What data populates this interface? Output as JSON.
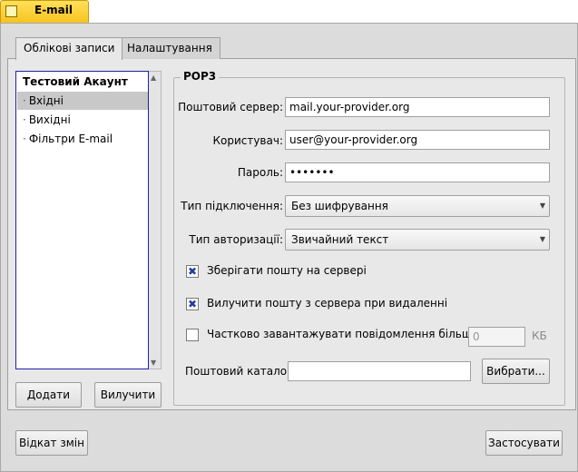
{
  "window": {
    "title": "E-mail"
  },
  "tabs": [
    {
      "label": "Облікові записи",
      "active": true
    },
    {
      "label": "Налаштування",
      "active": false
    }
  ],
  "accounts": {
    "root": "Тестовий Акаунт",
    "items": [
      {
        "label": "Вхідні",
        "selected": true
      },
      {
        "label": "Вихідні",
        "selected": false
      },
      {
        "label": "Фільтри E-mail",
        "selected": false
      }
    ],
    "bullet": "·",
    "add_label": "Додати",
    "remove_label": "Вилучити"
  },
  "pop3": {
    "group_title": "POP3",
    "server_label": "Поштовий сервер:",
    "server_value": "mail.your-provider.org",
    "user_label": "Користувач:",
    "user_value": "user@your-provider.org",
    "password_label": "Пароль:",
    "password_value": "•••••••",
    "connection_label": "Тип підключення:",
    "connection_value": "Без шифрування",
    "auth_label": "Тип авторизації:",
    "auth_value": "Звичайний текст",
    "keep_on_server_label": "Зберігати пошту на сервері",
    "keep_on_server_checked": true,
    "delete_on_remove_label": "Вилучити пошту з сервера при видаленні",
    "delete_on_remove_checked": true,
    "partial_label": "Частково завантажувати повідомлення більші ніж",
    "partial_checked": false,
    "partial_size_value": "0",
    "partial_unit": "КБ",
    "folder_label": "Поштовий каталог:",
    "folder_value": "",
    "browse_label": "Вибрати..."
  },
  "footer": {
    "revert_label": "Відкат змін",
    "apply_label": "Застосувати"
  },
  "icons": {
    "check_mark": "✖",
    "caret_down": "▼",
    "caret_up": "▲"
  }
}
